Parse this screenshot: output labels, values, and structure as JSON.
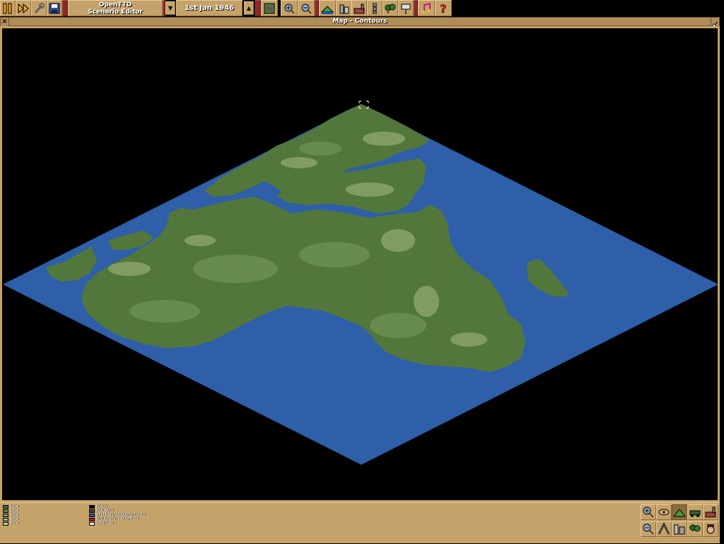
{
  "toolbar": {
    "title_line1": "OpenTTD",
    "title_line2": "Scenario Editor",
    "date": "1st Jan 1946",
    "buttons": [
      {
        "name": "pause-button",
        "icon": "pause-icon"
      },
      {
        "name": "fast-forward-button",
        "icon": "fast-forward-icon"
      },
      {
        "name": "settings-button",
        "icon": "wrench-icon"
      },
      {
        "name": "save-button",
        "icon": "disk-icon"
      },
      {
        "name": "map-button",
        "icon": "map-icon"
      },
      {
        "name": "zoom-in-button",
        "icon": "zoom-in-icon"
      },
      {
        "name": "zoom-out-button",
        "icon": "zoom-out-icon"
      },
      {
        "name": "landscape-button",
        "icon": "landscape-icon"
      },
      {
        "name": "town-button",
        "icon": "town-icon"
      },
      {
        "name": "industry-button",
        "icon": "industry-icon"
      },
      {
        "name": "road-button",
        "icon": "road-icon"
      },
      {
        "name": "trees-button",
        "icon": "trees-icon"
      },
      {
        "name": "signs-button",
        "icon": "sign-icon"
      },
      {
        "name": "music-button",
        "icon": "music-icon"
      },
      {
        "name": "help-button",
        "icon": "question-icon"
      }
    ]
  },
  "window": {
    "title": "Map - Contours"
  },
  "legend": {
    "heights": [
      {
        "label": "100m",
        "color": "#3c7040"
      },
      {
        "label": "200m",
        "color": "#5c8850"
      },
      {
        "label": "300m",
        "color": "#7ca064"
      },
      {
        "label": "400m",
        "color": "#a0b880"
      },
      {
        "label": "500m",
        "color": "#c8d4a8"
      }
    ],
    "overlays": [
      {
        "label": "ROADS",
        "color": "#000000"
      },
      {
        "label": "RAILWAYS",
        "color": "#404040"
      },
      {
        "label": "STATIONS/AIRPORTS/DOCKS",
        "color": "#3850d0"
      },
      {
        "label": "BUILDINGS/INDUSTRIES",
        "color": "#c02020"
      },
      {
        "label": "VEHICLES",
        "color": "#ffffff"
      }
    ]
  },
  "colors": {
    "water": "#2e5fa8",
    "land_low": "#4a6e34",
    "land_mid": "#6c8c4c",
    "land_high": "#a8bc84",
    "panel": "#c4a26a"
  }
}
